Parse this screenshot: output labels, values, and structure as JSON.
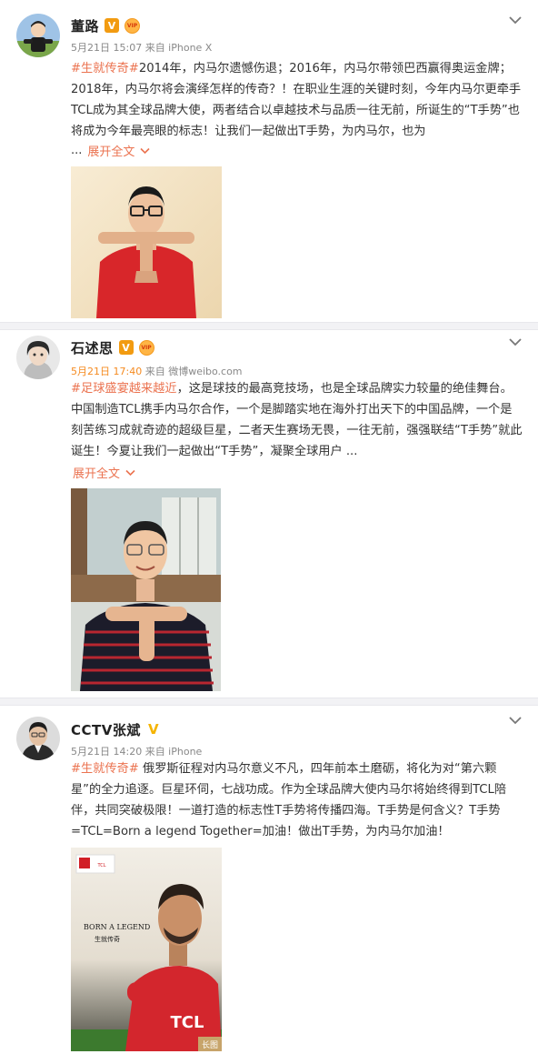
{
  "posts": [
    {
      "name": "董路",
      "badge": "V",
      "vip": "VIP",
      "meta": "5月21日 15:07 来自 iPhone X",
      "hashtag": "#生就传奇#",
      "body": "2014年，内马尔遗憾伤退；2016年，内马尔带领巴西赢得奥运金牌；2018年，内马尔将会演绎怎样的传奇？！在职业生涯的关键时刻，今年内马尔更牵手TCL成为其全球品牌大使，两者结合以卓越技术与品质一往无前，所诞生的“T手势”也将成为今年最亮眼的标志！让我们一起做出T手势，为内马尔，也为",
      "dots": "...",
      "expand": "展开全文"
    },
    {
      "name": "石述思",
      "badge": "V",
      "vip": "VIP",
      "meta_date": "5月21日 17:40",
      "meta_from": " 来自 微博weibo.com",
      "hashtag": "#足球盛宴越来越近",
      "body": "，这是球技的最高竞技场，也是全球品牌实力较量的绝佳舞台。中国制造TCL携手内马尔合作，一个是脚踏实地在海外打出天下的中国品牌，一个是刻苦练习成就奇迹的超级巨星，二者天生赛场无畏，一往无前，强强联结“T手势”就此诞生！今夏让我们一起做出“T手势”，凝聚全球用户 ...",
      "expand": "展开全文"
    },
    {
      "name": "CCTV张斌",
      "badge": "V",
      "meta": "5月21日 14:20 来自 iPhone",
      "hashtag": "#生就传奇#",
      "body": " 俄罗斯征程对内马尔意义不凡，四年前本土磨砺，将化为对“第六颗星”的全力追逐。巨星环伺，七战功成。作为全球品牌大使内马尔将始终得到TCL陪伴，共同突破极限！一道打造的标志性T手势将传播四海。T手势是何含义？T手势=TCL=Born a legend Together=加油！做出T手势，为内马尔加油！",
      "poster_title": "BORN A LEGEND",
      "poster_subtitle": "生就传奇",
      "poster_logo": "TCL",
      "jersey": "TCL",
      "long_image_label": "长图"
    }
  ]
}
